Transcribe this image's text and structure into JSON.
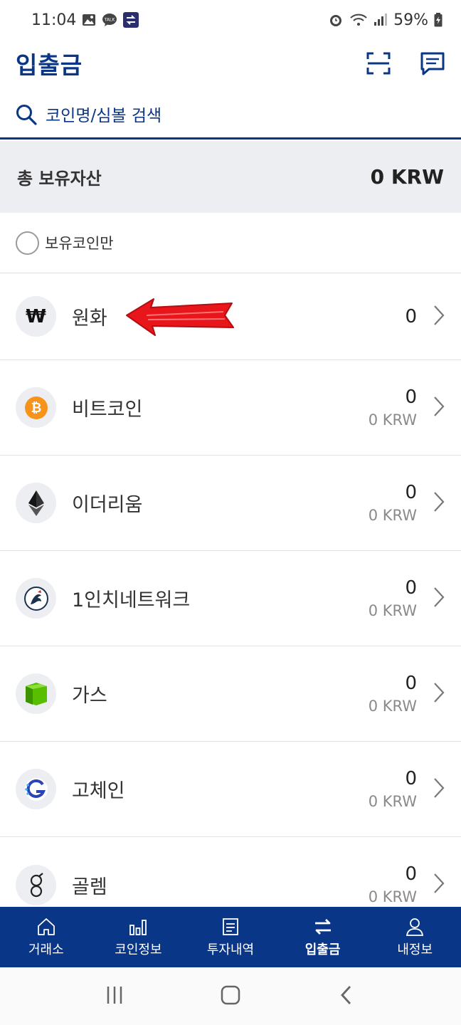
{
  "status_bar": {
    "time": "11:04",
    "talk_badge": "TALK",
    "battery": "59%"
  },
  "header": {
    "title": "입출금",
    "icons": [
      "scan-icon",
      "chat-icon"
    ]
  },
  "search": {
    "placeholder": "코인명/심볼 검색"
  },
  "total": {
    "label": "총 보유자산",
    "value": "0 KRW"
  },
  "filter": {
    "label": "보유코인만"
  },
  "coins": [
    {
      "name": "원화",
      "amount": "0",
      "krw": "",
      "icon": "won-icon",
      "symbol": "₩"
    },
    {
      "name": "비트코인",
      "amount": "0",
      "krw": "0 KRW",
      "icon": "bitcoin-icon",
      "color": "#f7931a"
    },
    {
      "name": "이더리움",
      "amount": "0",
      "krw": "0 KRW",
      "icon": "ethereum-icon",
      "color": "#333333"
    },
    {
      "name": "1인치네트워크",
      "amount": "0",
      "krw": "0 KRW",
      "icon": "1inch-icon",
      "color": "#1b314f"
    },
    {
      "name": "가스",
      "amount": "0",
      "krw": "0 KRW",
      "icon": "gas-icon",
      "color": "#58bf00"
    },
    {
      "name": "고체인",
      "amount": "0",
      "krw": "0 KRW",
      "icon": "gochain-icon",
      "color": "#2a43b8"
    },
    {
      "name": "골렘",
      "amount": "0",
      "krw": "0 KRW",
      "icon": "golem-icon",
      "color": "#222222"
    }
  ],
  "bottom_nav": [
    {
      "label": "거래소",
      "icon": "home-icon"
    },
    {
      "label": "코인정보",
      "icon": "bar-chart-icon"
    },
    {
      "label": "투자내역",
      "icon": "document-icon"
    },
    {
      "label": "입출금",
      "icon": "transfer-icon",
      "active": true
    },
    {
      "label": "내정보",
      "icon": "person-icon"
    }
  ],
  "colors": {
    "brand": "#093687",
    "total_bg": "#eceef1",
    "annotation_arrow": "#e8151b"
  }
}
